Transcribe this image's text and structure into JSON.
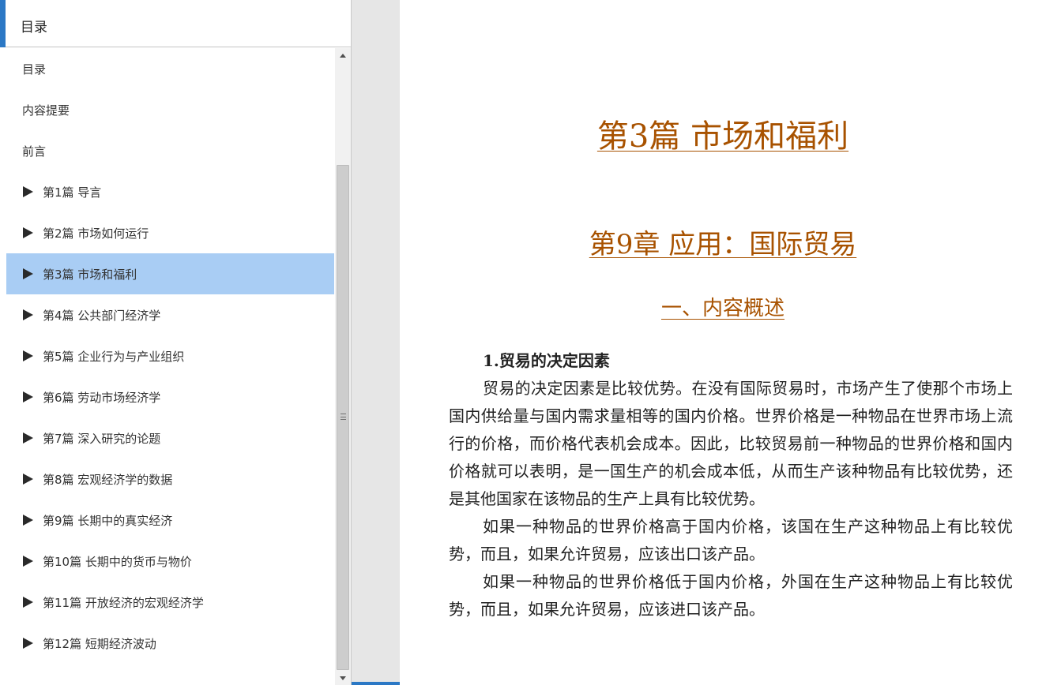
{
  "sidebar": {
    "header_title": "目录",
    "items": [
      {
        "label": "目录",
        "expandable": false
      },
      {
        "label": "内容提要",
        "expandable": false
      },
      {
        "label": "前言",
        "expandable": false
      },
      {
        "label": "第1篇 导言",
        "expandable": true
      },
      {
        "label": "第2篇 市场如何运行",
        "expandable": true
      },
      {
        "label": "第3篇 市场和福利",
        "expandable": true,
        "selected": true
      },
      {
        "label": "第4篇 公共部门经济学",
        "expandable": true
      },
      {
        "label": "第5篇 企业行为与产业组织",
        "expandable": true
      },
      {
        "label": "第6篇 劳动市场经济学",
        "expandable": true
      },
      {
        "label": "第7篇 深入研究的论题",
        "expandable": true
      },
      {
        "label": "第8篇 宏观经济学的数据",
        "expandable": true
      },
      {
        "label": "第9篇 长期中的真实经济",
        "expandable": true
      },
      {
        "label": "第10篇 长期中的货币与物价",
        "expandable": true
      },
      {
        "label": "第11篇 开放经济的宏观经济学",
        "expandable": true
      },
      {
        "label": "第12篇 短期经济波动",
        "expandable": true
      }
    ]
  },
  "content": {
    "part_title": "第3篇  市场和福利",
    "chapter_title": "第9章  应用：国际贸易",
    "section_title": "一、内容概述",
    "subheading": "1.贸易的决定因素",
    "paragraphs": [
      "贸易的决定因素是比较优势。在没有国际贸易时，市场产生了使那个市场上国内供给量与国内需求量相等的国内价格。世界价格是一种物品在世界市场上流行的价格，而价格代表机会成本。因此，比较贸易前一种物品的世界价格和国内价格就可以表明，是一国生产的机会成本低，从而生产该种物品有比较优势，还是其他国家在该物品的生产上具有比较优势。",
      "如果一种物品的世界价格高于国内价格，该国在生产这种物品上有比较优势，而且，如果允许贸易，应该出口该产品。",
      "如果一种物品的世界价格低于国内价格，外国在生产这种物品上有比较优势，而且，如果允许贸易，应该进口该产品。"
    ]
  },
  "colors": {
    "accent": "#2b78c5",
    "selected_bg": "#a9cdf4",
    "heading": "#a85200"
  },
  "reading_progress_fraction": 0.24
}
